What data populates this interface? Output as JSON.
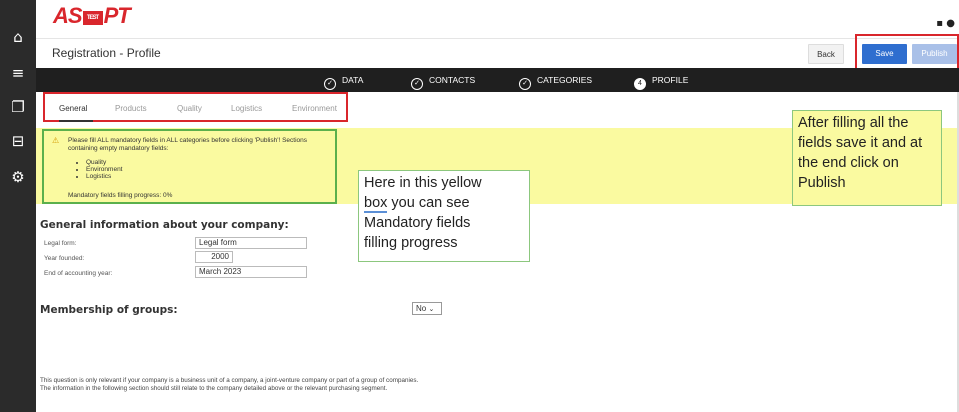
{
  "app": {
    "logo_left": "AS",
    "logo_mark": "TEST",
    "logo_right": "PT"
  },
  "header": {
    "title": "Registration - Profile",
    "buttons": {
      "back": "Back",
      "save": "Save",
      "publish": "Publish"
    }
  },
  "steps": [
    {
      "label": "DATA",
      "marker": "✓"
    },
    {
      "label": "CONTACTS",
      "marker": "✓"
    },
    {
      "label": "CATEGORIES",
      "marker": "✓"
    },
    {
      "label": "PROFILE",
      "marker": "4"
    }
  ],
  "tabs": [
    "General",
    "Products",
    "Quality",
    "Logistics",
    "Environment"
  ],
  "warning": {
    "text": "Please fill ALL mandatory fields in ALL categories before clicking 'Publish'! Sections containing empty mandatory fields:",
    "sections": [
      "Quality",
      "Environment",
      "Logistics"
    ],
    "progress": "Mandatory fields filling progress: 0%"
  },
  "callouts": {
    "left_line1": "Here in this yellow",
    "left_line2_a": "box",
    "left_line2_b": " you can see",
    "left_line3": "Mandatory fields",
    "left_line4": "filling progress",
    "right": "After filling all the fields save it and at the end click on Publish"
  },
  "general_info": {
    "title": "General information about your company:",
    "fields": [
      {
        "label": "Legal form:",
        "value": "Legal form"
      },
      {
        "label": "Year founded:",
        "value": "2000"
      },
      {
        "label": "End of accounting year:",
        "value": "March 2023"
      }
    ]
  },
  "membership": {
    "title": "Membership of groups:",
    "selected": "No"
  },
  "footnote": "This question is only relevant if your company is a business unit of a company, a joint-venture company or part of a group of companies. The information in the following section should still relate to the company detailed above or the relevant purchasing segment."
}
